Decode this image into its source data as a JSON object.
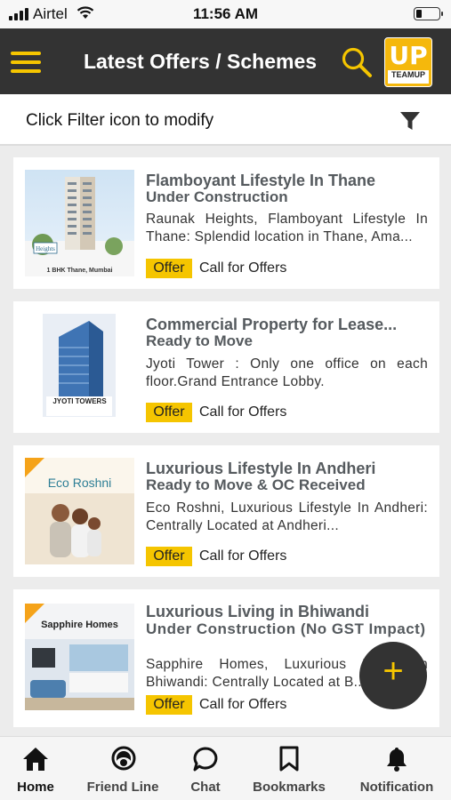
{
  "status": {
    "carrier": "Airtel",
    "time": "11:56 AM"
  },
  "header": {
    "title": "Latest Offers / Schemes",
    "logo_text": "UP",
    "logo_sub": "TEAMUP"
  },
  "filter": {
    "hint": "Click Filter icon to modify"
  },
  "offers": [
    {
      "title": "Flamboyant Lifestyle In Thane",
      "status": "Under Construction",
      "description": "Raunak Heights, Flamboyant Lifestyle In Thane: Splendid location in Thane, Ama...",
      "badge": "Offer",
      "cta": "Call for Offers",
      "thumb_caption": "1 BHK Thane, Mumbai"
    },
    {
      "title": "Commercial Property for Lease...",
      "status": "Ready to Move",
      "description": "Jyoti Tower : Only one office on each floor.Grand Entrance Lobby.",
      "badge": "Offer",
      "cta": "Call for Offers",
      "thumb_caption": "JYOTI TOWERS"
    },
    {
      "title": "Luxurious Lifestyle In Andheri",
      "status": "Ready to Move & OC Received",
      "description": "Eco Roshni, Luxurious Lifestyle In Andheri: Centrally Located at Andheri...",
      "badge": "Offer",
      "cta": "Call for Offers",
      "thumb_caption": "Eco Roshni"
    },
    {
      "title": "Luxurious Living in Bhiwandi",
      "status": "Under Construction (No GST Impact)",
      "description": "Sapphire Homes, Luxurious Living In Bhiwandi: Centrally Located at B...",
      "badge": "Offer",
      "cta": "Call for Offers",
      "thumb_caption": "Sapphire Homes"
    }
  ],
  "fab": {
    "label": "+"
  },
  "nav": [
    {
      "label": "Home",
      "icon": "home-icon",
      "active": true
    },
    {
      "label": "Friend Line",
      "icon": "friend-line-icon"
    },
    {
      "label": "Chat",
      "icon": "chat-icon"
    },
    {
      "label": "Bookmarks",
      "icon": "bookmark-icon"
    },
    {
      "label": "Notification",
      "icon": "bell-icon"
    }
  ],
  "colors": {
    "accent": "#f5c500",
    "appbar": "#333333",
    "title_text": "#555a5e"
  }
}
